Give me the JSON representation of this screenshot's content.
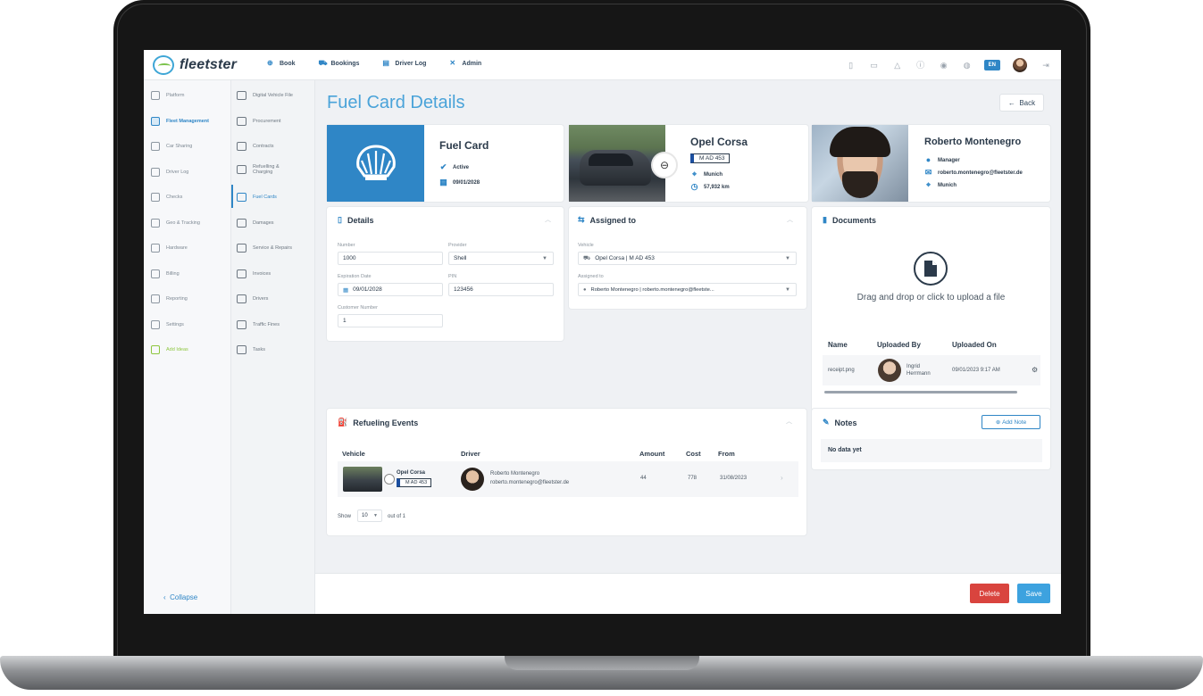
{
  "app": {
    "brand": "fleetster",
    "accent": "#2f86c6",
    "brand_green": "#8dc63f"
  },
  "topnav": {
    "items": [
      {
        "label": "Book",
        "icon": "plus-circle-icon"
      },
      {
        "label": "Bookings",
        "icon": "car-icon"
      },
      {
        "label": "Driver Log",
        "icon": "log-icon"
      },
      {
        "label": "Admin",
        "icon": "tools-icon"
      }
    ],
    "language": "EN"
  },
  "sidebar": {
    "items": [
      {
        "label": "Platform"
      },
      {
        "label": "Fleet Management"
      },
      {
        "label": "Car Sharing"
      },
      {
        "label": "Driver Log"
      },
      {
        "label": "Checks"
      },
      {
        "label": "Geo & Tracking"
      },
      {
        "label": "Hardware"
      },
      {
        "label": "Billing"
      },
      {
        "label": "Reporting"
      },
      {
        "label": "Settings"
      },
      {
        "label": "Add Ideas"
      }
    ],
    "collapse": "Collapse"
  },
  "subnav": {
    "items": [
      {
        "label": "Digital Vehicle File"
      },
      {
        "label": "Procurement"
      },
      {
        "label": "Contracts"
      },
      {
        "label": "Refuelling & Charging"
      },
      {
        "label": "Fuel Cards"
      },
      {
        "label": "Damages"
      },
      {
        "label": "Service & Repairs"
      },
      {
        "label": "Invoices"
      },
      {
        "label": "Drivers"
      },
      {
        "label": "Traffic Fines"
      },
      {
        "label": "Tasks"
      }
    ]
  },
  "page": {
    "title": "Fuel Card Details",
    "back": "Back"
  },
  "fuel_card": {
    "title": "Fuel Card",
    "status": "Active",
    "date": "09/01/2028"
  },
  "vehicle": {
    "name": "Opel Corsa",
    "plate": "M AD 453",
    "location": "Munich",
    "mileage": "57,932 km"
  },
  "person": {
    "name": "Roberto Montenegro",
    "role": "Manager",
    "email": "roberto.montenegro@fleetster.de",
    "location": "Munich"
  },
  "details": {
    "title": "Details",
    "number_label": "Number",
    "number": "1000",
    "provider_label": "Provider",
    "provider": "Shell",
    "expiration_label": "Expiration Date",
    "expiration": "09/01/2028",
    "pin_label": "PIN",
    "pin": "123456",
    "customer_label": "Customer Number",
    "customer": "1"
  },
  "assigned": {
    "title": "Assigned to",
    "vehicle_label": "Vehicle",
    "vehicle_value": "Opel Corsa | M AD 453",
    "assigned_label": "Assigned to",
    "assigned_value": "Roberto Montenegro | roberto.montenegro@fleetste..."
  },
  "documents": {
    "title": "Documents",
    "upload_text": "Drag and drop or click to upload a file",
    "headers": [
      "Name",
      "Uploaded By",
      "Uploaded On"
    ],
    "rows": [
      {
        "name": "receipt.png",
        "by": "Ingrid Herrmann",
        "on": "09/01/2023 9:17 AM"
      }
    ]
  },
  "refuel": {
    "title": "Refueling Events",
    "headers": [
      "Vehicle",
      "Driver",
      "Amount",
      "Cost",
      "From"
    ],
    "rows": [
      {
        "vehicle": "Opel Corsa",
        "plate": "M AD 453",
        "driver": "Roberto Montenegro",
        "email": "roberto.montenegro@fleetster.de",
        "amount": "44",
        "cost": "778",
        "from": "31/08/2023"
      }
    ],
    "show_label": "Show",
    "page_size": "10",
    "count": "out of 1"
  },
  "notes": {
    "title": "Notes",
    "add": "Add Note",
    "empty": "No data yet"
  },
  "actions": {
    "delete": "Delete",
    "save": "Save"
  }
}
